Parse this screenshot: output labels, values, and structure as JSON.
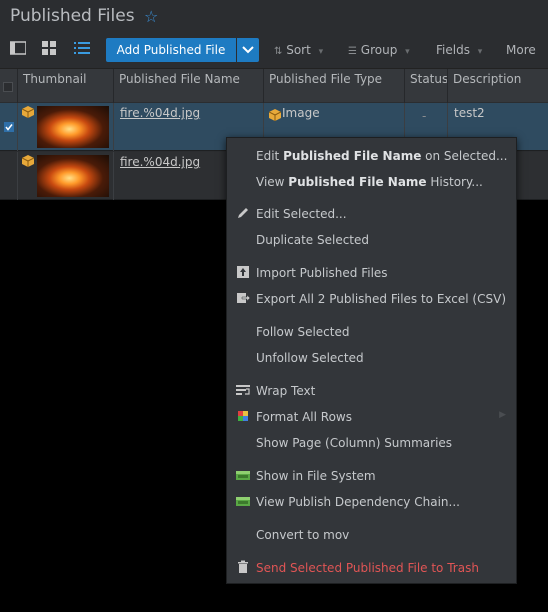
{
  "title": "Published Files",
  "toolbar": {
    "add_label": "Add Published File",
    "sort": "Sort",
    "group": "Group",
    "fields": "Fields",
    "more": "More"
  },
  "columns": [
    "Thumbnail",
    "Published File Name",
    "Published File Type",
    "Status",
    "Description"
  ],
  "rows": [
    {
      "selected": true,
      "name": "fire.%04d.jpg",
      "type": "Image",
      "status": "-",
      "description": "test2"
    },
    {
      "selected": false,
      "name": "fire.%04d.jpg",
      "type": "",
      "status": "",
      "description": ""
    }
  ],
  "menu": {
    "edit_prefix": "Edit ",
    "edit_bold": "Published File Name",
    "edit_suffix": " on Selected...",
    "view_prefix": "View ",
    "view_bold": "Published File Name",
    "view_suffix": " History...",
    "edit_selected": "Edit Selected...",
    "duplicate": "Duplicate Selected",
    "import": "Import Published Files",
    "export": "Export All 2 Published Files to Excel (CSV)",
    "follow": "Follow Selected",
    "unfollow": "Unfollow Selected",
    "wrap": "Wrap Text",
    "format": "Format All Rows",
    "summaries": "Show Page (Column) Summaries",
    "file_system": "Show in File System",
    "dependency": "View Publish Dependency Chain...",
    "convert": "Convert to mov",
    "trash": "Send Selected Published File to Trash"
  },
  "colors": {
    "accent": "#1e7bc2",
    "selected_row": "#2f4b60",
    "danger": "#e05555"
  }
}
